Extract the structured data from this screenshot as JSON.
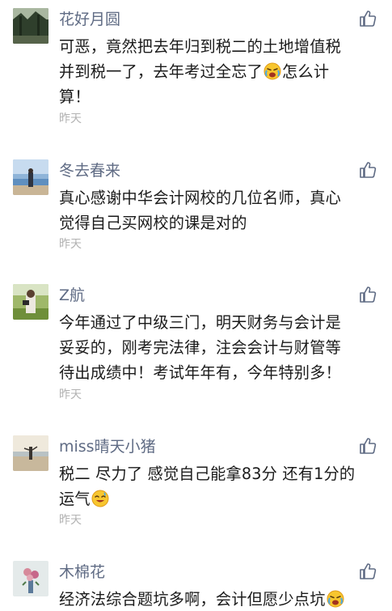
{
  "comments": [
    {
      "name": "花好月圆",
      "text_a": "可恶，竟然把去年归到税二的土地增值税\n并到税一了，去年考过全忘了",
      "emoji": "crying-face",
      "text_b": "怎么计\n算！",
      "time": "昨天"
    },
    {
      "name": "冬去春来",
      "text_a": "真心感谢中华会计网校的几位名师，真心\n觉得自己买网校的课是对的",
      "time": "昨天"
    },
    {
      "name": "Z航",
      "text_a": "今年通过了中级三门，明天财务与会计是\n妥妥的，刚考完法律，注会会计与财管等\n待出成绩中！考试年年有，今年特别多！",
      "time": "昨天"
    },
    {
      "name": "miss晴天小猪",
      "text_a": "税二 尽力了 感觉自己能拿83分 还有1分的\n运气",
      "emoji": "sweat-smile-face",
      "time": "昨天"
    },
    {
      "name": "木棉花",
      "text_a": "经济法综合题坑多啊，会计但愿少点坑",
      "emoji": "crying-face"
    }
  ],
  "colors": {
    "name": "#5f6b84",
    "text": "#1a1a1a",
    "time": "#b2b2b2",
    "like_icon": "#5f6b84"
  },
  "icons": {
    "like": "thumbs-up-icon"
  }
}
